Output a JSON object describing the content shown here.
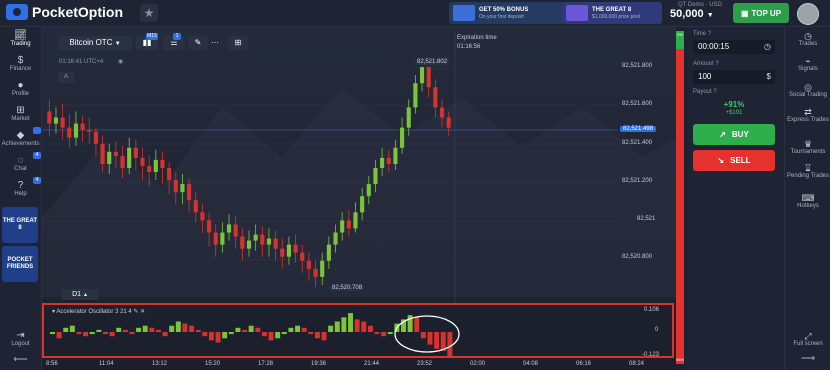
{
  "app": {
    "name": "PocketOption"
  },
  "promos": [
    {
      "title": "GET 50% BONUS",
      "subtitle": "On your first deposit"
    },
    {
      "title": "THE GREAT 8",
      "subtitle": "$1,000,000 prize pool"
    }
  ],
  "account": {
    "label": "QT Demo · USD",
    "balance": "50,000",
    "topup": "TOP UP"
  },
  "left_sidebar": {
    "items": [
      "Trading",
      "Finance",
      "Profile",
      "Market",
      "Achievements",
      "Chat",
      "Help"
    ],
    "badges": [
      "4",
      "4"
    ],
    "tiles": [
      "THE GREAT 8",
      "POCKET FRIENDS"
    ],
    "logout": "Logout"
  },
  "right_sidebar": {
    "items": [
      "Trades",
      "Signals",
      "Social Trading",
      "Express Trades",
      "Tournaments",
      "Pending Trades",
      "Hotkeys"
    ],
    "fullscreen": "Full screen"
  },
  "chart_header": {
    "asset": "Bitcoin OTC",
    "time_badges": [
      "M15",
      "1"
    ],
    "clock": "01:16:41 UTC+4",
    "timeframe": "D1",
    "expiration_label": "Expiration time",
    "expiration_value": "01:16:56",
    "indicator_name": "Accelerator Oscillator",
    "indicator_params": "3 21 4",
    "hl_label": "A"
  },
  "trade_panel": {
    "time_label": "Time",
    "time_value": "00:00:15",
    "amount_label": "Amount",
    "amount_value": "100",
    "payout_label": "Payout",
    "payout_pct": "+91%",
    "payout_amt": "+$191",
    "buy_label": "BUY",
    "sell_label": "SELL"
  },
  "sentiment": {
    "top": "0%",
    "bottom": "98%"
  },
  "colors": {
    "up": "#7cc43a",
    "down": "#d8322e",
    "accent": "#2f6fe8"
  },
  "chart_data": {
    "type": "candlestick",
    "price_axis": [
      "82,521.800",
      "82,521.600",
      "82,521.400",
      "82,521.200",
      "82,521",
      "82,520.800"
    ],
    "current_price": "82,521.498",
    "high_label": "82,521.802",
    "low_label": "82,520.708",
    "time_axis": [
      "8:56",
      "11:04",
      "13:12",
      "15:20",
      "17:28",
      "19:36",
      "21:44",
      "23:52",
      "02:00",
      "04:08",
      "06:16",
      "08:24"
    ],
    "ylim": [
      82520.7,
      82521.85
    ],
    "candles": [
      [
        82521.58,
        82521.52,
        82521.64,
        82521.46
      ],
      [
        82521.52,
        82521.55,
        82521.6,
        82521.47
      ],
      [
        82521.55,
        82521.5,
        82521.62,
        82521.44
      ],
      [
        82521.5,
        82521.45,
        82521.57,
        82521.4
      ],
      [
        82521.45,
        82521.52,
        82521.58,
        82521.41
      ],
      [
        82521.52,
        82521.49,
        82521.56,
        82521.43
      ],
      [
        82521.49,
        82521.48,
        82521.55,
        82521.42
      ],
      [
        82521.48,
        82521.42,
        82521.5,
        82521.36
      ],
      [
        82521.42,
        82521.32,
        82521.46,
        82521.28
      ],
      [
        82521.32,
        82521.38,
        82521.42,
        82521.27
      ],
      [
        82521.38,
        82521.36,
        82521.43,
        82521.3
      ],
      [
        82521.36,
        82521.3,
        82521.41,
        82521.25
      ],
      [
        82521.3,
        82521.4,
        82521.45,
        82521.27
      ],
      [
        82521.4,
        82521.35,
        82521.44,
        82521.29
      ],
      [
        82521.35,
        82521.31,
        82521.4,
        82521.24
      ],
      [
        82521.31,
        82521.28,
        82521.36,
        82521.21
      ],
      [
        82521.28,
        82521.34,
        82521.39,
        82521.24
      ],
      [
        82521.34,
        82521.3,
        82521.38,
        82521.22
      ],
      [
        82521.3,
        82521.24,
        82521.33,
        82521.17
      ],
      [
        82521.24,
        82521.18,
        82521.28,
        82521.12
      ],
      [
        82521.18,
        82521.22,
        82521.27,
        82521.12
      ],
      [
        82521.22,
        82521.14,
        82521.25,
        82521.08
      ],
      [
        82521.14,
        82521.08,
        82521.18,
        82521.03
      ],
      [
        82521.08,
        82521.04,
        82521.12,
        82520.98
      ],
      [
        82521.04,
        82520.98,
        82521.08,
        82520.91
      ],
      [
        82520.98,
        82520.92,
        82521.02,
        82520.86
      ],
      [
        82520.92,
        82520.98,
        82521.03,
        82520.88
      ],
      [
        82520.98,
        82521.02,
        82521.07,
        82520.94
      ],
      [
        82521.02,
        82520.96,
        82521.06,
        82520.9
      ],
      [
        82520.96,
        82520.9,
        82521.0,
        82520.84
      ],
      [
        82520.9,
        82520.94,
        82520.99,
        82520.86
      ],
      [
        82520.94,
        82520.97,
        82521.02,
        82520.89
      ],
      [
        82520.97,
        82520.92,
        82521.01,
        82520.86
      ],
      [
        82520.92,
        82520.95,
        82521.0,
        82520.86
      ],
      [
        82520.95,
        82520.9,
        82520.99,
        82520.84
      ],
      [
        82520.9,
        82520.86,
        82520.95,
        82520.8
      ],
      [
        82520.86,
        82520.92,
        82520.96,
        82520.82
      ],
      [
        82520.92,
        82520.88,
        82520.97,
        82520.83
      ],
      [
        82520.88,
        82520.84,
        82520.92,
        82520.78
      ],
      [
        82520.84,
        82520.8,
        82520.88,
        82520.74
      ],
      [
        82520.8,
        82520.76,
        82520.84,
        82520.71
      ],
      [
        82520.76,
        82520.84,
        82520.88,
        82520.72
      ],
      [
        82520.84,
        82520.92,
        82520.96,
        82520.8
      ],
      [
        82520.92,
        82520.98,
        82521.02,
        82520.88
      ],
      [
        82520.98,
        82521.04,
        82521.08,
        82520.94
      ],
      [
        82521.04,
        82521.0,
        82521.09,
        82520.96
      ],
      [
        82521.0,
        82521.08,
        82521.13,
        82520.98
      ],
      [
        82521.08,
        82521.16,
        82521.2,
        82521.04
      ],
      [
        82521.16,
        82521.22,
        82521.26,
        82521.12
      ],
      [
        82521.22,
        82521.3,
        82521.34,
        82521.18
      ],
      [
        82521.3,
        82521.35,
        82521.4,
        82521.26
      ],
      [
        82521.35,
        82521.32,
        82521.39,
        82521.28
      ],
      [
        82521.32,
        82521.4,
        82521.44,
        82521.29
      ],
      [
        82521.4,
        82521.5,
        82521.55,
        82521.37
      ],
      [
        82521.5,
        82521.6,
        82521.64,
        82521.46
      ],
      [
        82521.6,
        82521.72,
        82521.76,
        82521.57
      ],
      [
        82521.72,
        82521.8,
        82521.8,
        82521.68
      ],
      [
        82521.8,
        82521.7,
        82521.8,
        82521.65
      ],
      [
        82521.7,
        82521.6,
        82521.74,
        82521.55
      ],
      [
        82521.6,
        82521.55,
        82521.64,
        82521.5
      ],
      [
        82521.55,
        82521.5,
        82521.58,
        82521.46
      ]
    ],
    "oscillator": {
      "name": "Accelerator Oscillator",
      "levels": [
        "0.106",
        "0",
        "-0.123"
      ],
      "values": [
        -0.01,
        -0.03,
        0.02,
        0.03,
        -0.01,
        -0.02,
        -0.01,
        0.01,
        -0.01,
        -0.02,
        0.02,
        0.01,
        -0.01,
        0.02,
        0.03,
        0.02,
        0.01,
        -0.02,
        0.03,
        0.05,
        0.04,
        0.03,
        0.01,
        -0.02,
        -0.04,
        -0.05,
        -0.03,
        -0.01,
        0.02,
        0.01,
        0.03,
        0.02,
        -0.02,
        -0.04,
        -0.03,
        -0.01,
        0.02,
        0.03,
        0.02,
        -0.01,
        -0.03,
        -0.04,
        0.03,
        0.05,
        0.07,
        0.09,
        0.06,
        0.05,
        0.03,
        -0.01,
        -0.02,
        -0.01,
        0.04,
        0.06,
        0.08,
        0.07,
        -0.03,
        -0.06,
        -0.08,
        -0.09,
        -0.12
      ]
    }
  }
}
